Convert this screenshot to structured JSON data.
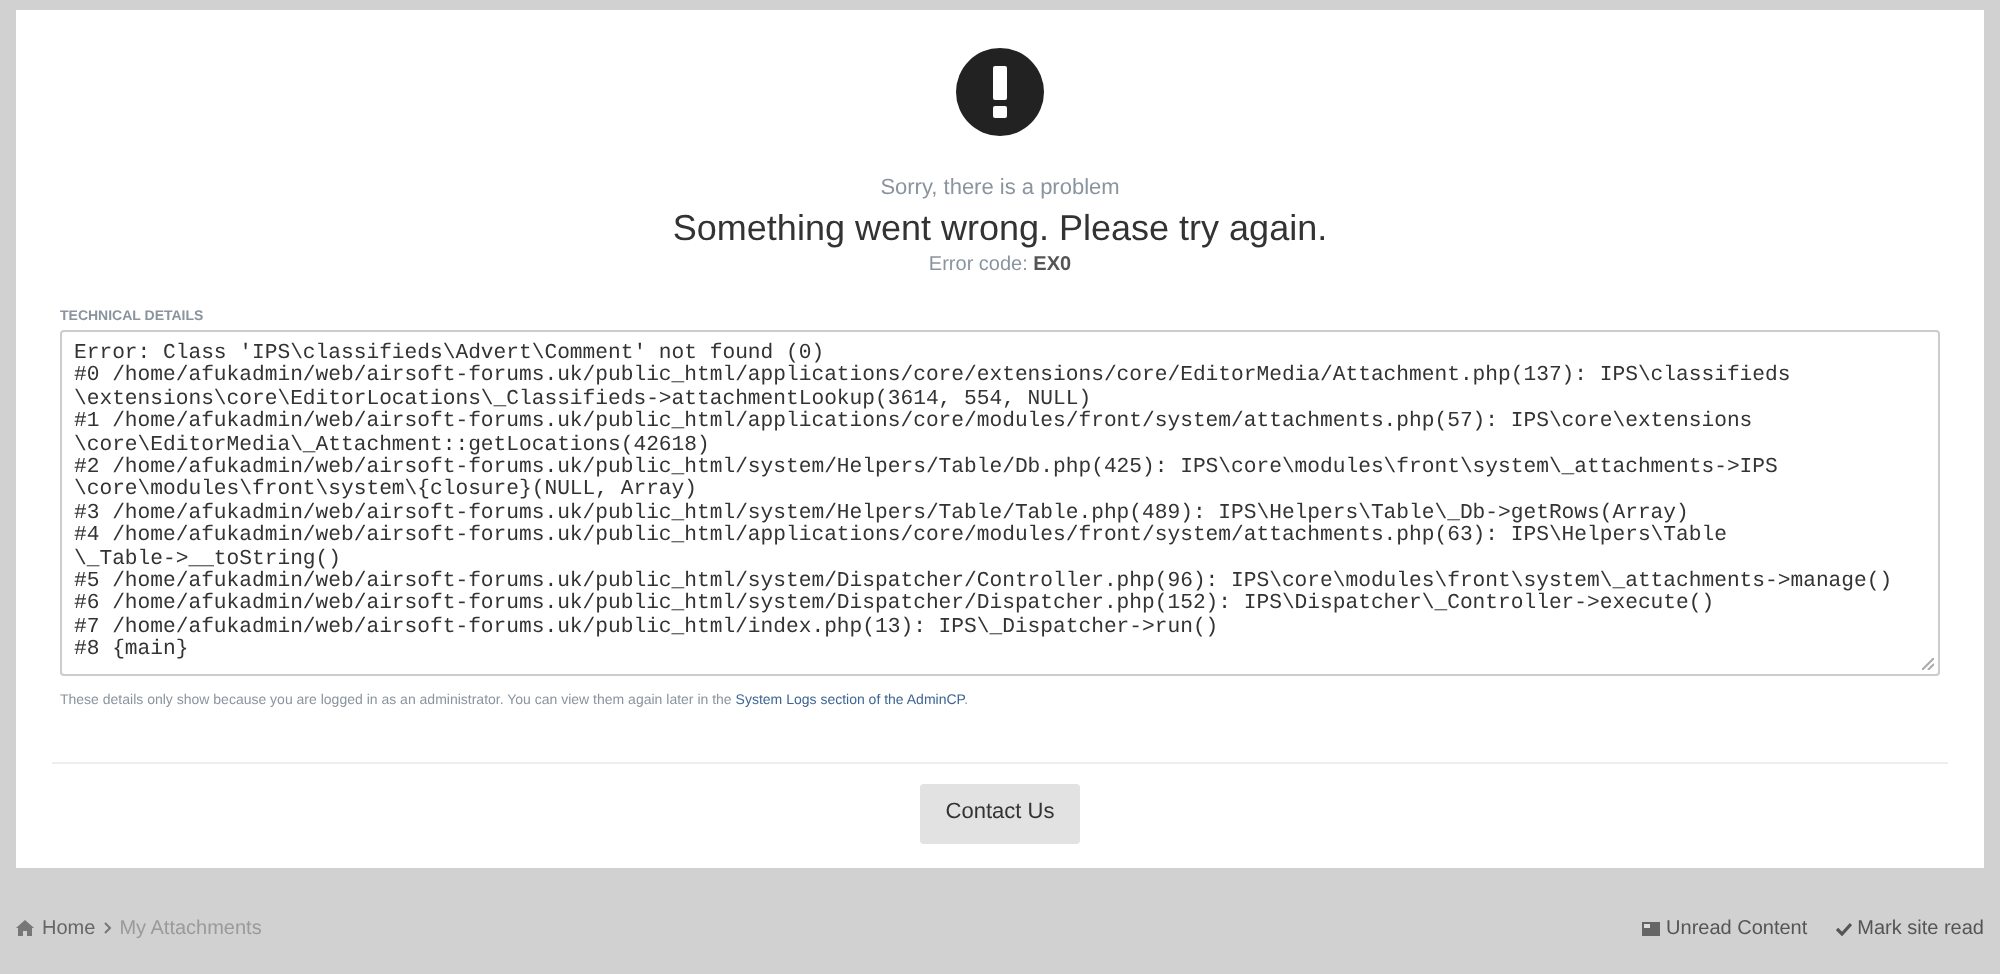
{
  "error": {
    "subtitle": "Sorry, there is a problem",
    "title": "Something went wrong. Please try again.",
    "code_label": "Error code:",
    "code": "EX0"
  },
  "technical_details": {
    "heading": "TECHNICAL DETAILS",
    "lines": [
      "Error: Class 'IPS\\classifieds\\Advert\\Comment' not found (0)",
      "#0 /home/afukadmin/web/airsoft-forums.uk/public_html/applications/core/extensions/core/EditorMedia/Attachment.php(137): IPS\\classifieds",
      "\\extensions\\core\\EditorLocations\\_Classifieds->attachmentLookup(3614, 554, NULL)",
      "#1 /home/afukadmin/web/airsoft-forums.uk/public_html/applications/core/modules/front/system/attachments.php(57): IPS\\core\\extensions",
      "\\core\\EditorMedia\\_Attachment::getLocations(42618)",
      "#2 /home/afukadmin/web/airsoft-forums.uk/public_html/system/Helpers/Table/Db.php(425): IPS\\core\\modules\\front\\system\\_attachments->IPS",
      "\\core\\modules\\front\\system\\{closure}(NULL, Array)",
      "#3 /home/afukadmin/web/airsoft-forums.uk/public_html/system/Helpers/Table/Table.php(489): IPS\\Helpers\\Table\\_Db->getRows(Array)",
      "#4 /home/afukadmin/web/airsoft-forums.uk/public_html/applications/core/modules/front/system/attachments.php(63): IPS\\Helpers\\Table",
      "\\_Table->__toString()",
      "#5 /home/afukadmin/web/airsoft-forums.uk/public_html/system/Dispatcher/Controller.php(96): IPS\\core\\modules\\front\\system\\_attachments->manage()",
      "#6 /home/afukadmin/web/airsoft-forums.uk/public_html/system/Dispatcher/Dispatcher.php(152): IPS\\Dispatcher\\_Controller->execute()",
      "#7 /home/afukadmin/web/airsoft-forums.uk/public_html/index.php(13): IPS\\_Dispatcher->run()",
      "#8 {main}"
    ],
    "note": "These details only show because you are logged in as an administrator. You can view them again later in the",
    "note_link": "System Logs section of the AdminCP",
    "note_end": "."
  },
  "contact_button": "Contact Us",
  "breadcrumb": [
    {
      "label": "Home",
      "kind": "home"
    },
    {
      "label": "My Attachments",
      "kind": "current"
    }
  ],
  "footer_links": [
    {
      "label": "Unread Content",
      "kind": "unread"
    },
    {
      "label": "Mark site read",
      "kind": "mark"
    }
  ]
}
